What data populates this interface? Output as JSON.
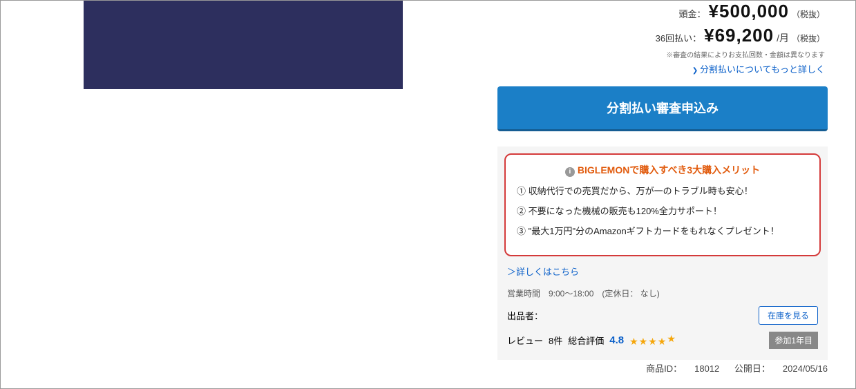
{
  "pricing": {
    "down_label": "頭金：",
    "down_value": "¥500,000",
    "down_tax": "（税抜）",
    "install_label": "36回払い：",
    "install_value": "¥69,200",
    "install_month": "/月",
    "install_tax": "（税抜）",
    "note": "※審査の結果によりお支払回数・金額は異なります",
    "link": "分割払いについてもっと詳しく"
  },
  "apply_button": "分割払い審査申込み",
  "merits": {
    "title": "BIGLEMONで購入すべき3大購入メリット",
    "items": [
      "① 収納代行での売買だから、万が一のトラブル時も安心！",
      "② 不要になった機械の販売も120%全力サポート！",
      "③ \"最大1万円\"分のAmazonギフトカードをもれなくプレゼント！"
    ],
    "detail_link": "＞詳しくはこちら"
  },
  "hours": "営業時間　9:00～18:00　(定休日：  なし)",
  "seller_label": "出品者：",
  "stock_button": "在庫を見る",
  "review": {
    "label": "レビュー",
    "count": "8件",
    "rating_label": "総合評価",
    "score": "4.8",
    "badge": "参加1年目"
  },
  "footer": {
    "id_label": "商品ID：",
    "id_value": "18012",
    "date_label": "公開日：",
    "date_value": "2024/05/16"
  }
}
